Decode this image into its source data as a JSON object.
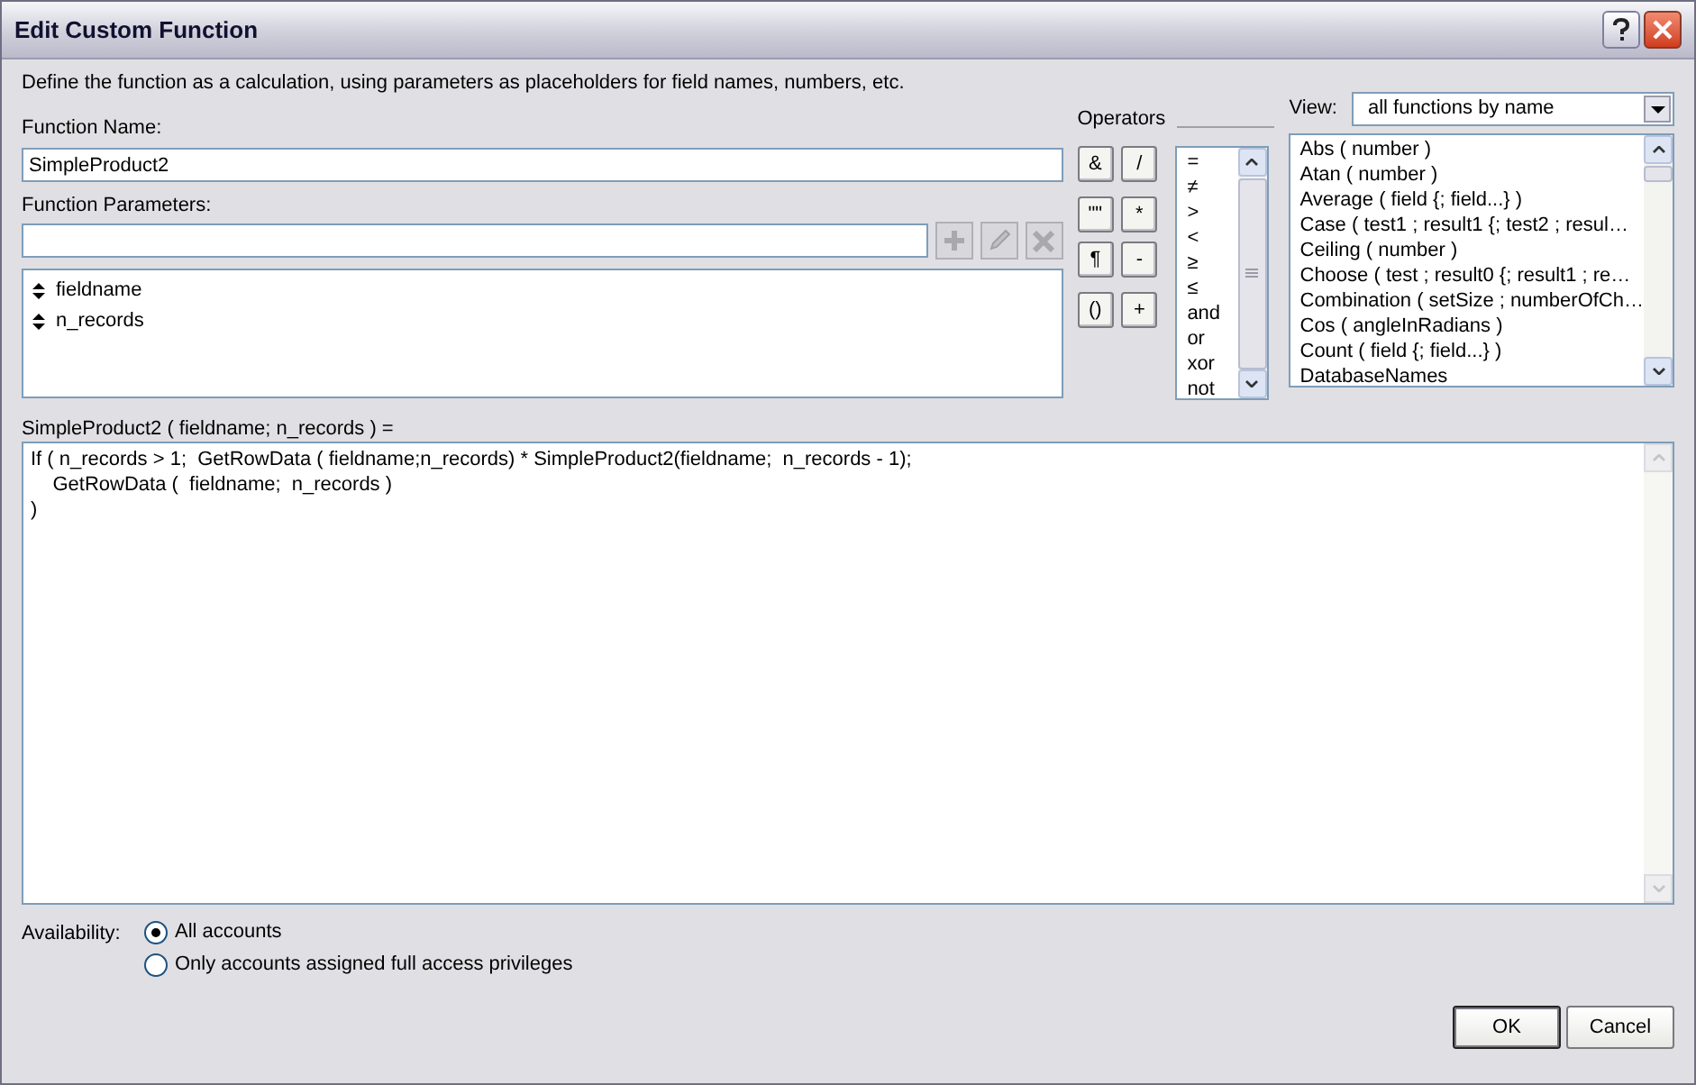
{
  "window": {
    "title": "Edit Custom Function"
  },
  "description": "Define the function as a calculation, using parameters as placeholders for field names, numbers, etc.",
  "function_name": {
    "label": "Function Name:",
    "value": "SimpleProduct2"
  },
  "parameters": {
    "label": "Function Parameters:",
    "items": [
      "fieldname",
      "n_records"
    ]
  },
  "operators": {
    "label": "Operators",
    "buttons": [
      "&",
      "/",
      "\"\"",
      "*",
      "¶",
      "-",
      "()",
      "+"
    ],
    "list": [
      "=",
      "≠",
      ">",
      "<",
      "≥",
      "≤",
      "and",
      "or",
      "xor",
      "not"
    ]
  },
  "view": {
    "label": "View:",
    "value": "all functions by name",
    "functions": [
      "Abs ( number )",
      "Atan ( number )",
      "Average ( field {; field...} )",
      "Case ( test1 ; result1 {; test2 ; resul…",
      "Ceiling ( number )",
      "Choose ( test ; result0 {; result1 ; re…",
      "Combination ( setSize ; numberOfCh…",
      "Cos ( angleInRadians )",
      "Count ( field {; field...} )",
      "DatabaseNames"
    ]
  },
  "calculation": {
    "label": "SimpleProduct2 ( fieldname; n_records ) =",
    "lines": [
      "If ( n_records > 1;  GetRowData ( fieldname;n_records) * SimpleProduct2(fieldname;  n_records - 1);",
      "    GetRowData (  fieldname;  n_records )",
      ")"
    ]
  },
  "availability": {
    "label": "Availability:",
    "options": [
      {
        "label": "All accounts",
        "selected": true
      },
      {
        "label": "Only accounts assigned full access privileges",
        "selected": false
      }
    ]
  },
  "buttons": [
    "OK",
    "Cancel"
  ]
}
